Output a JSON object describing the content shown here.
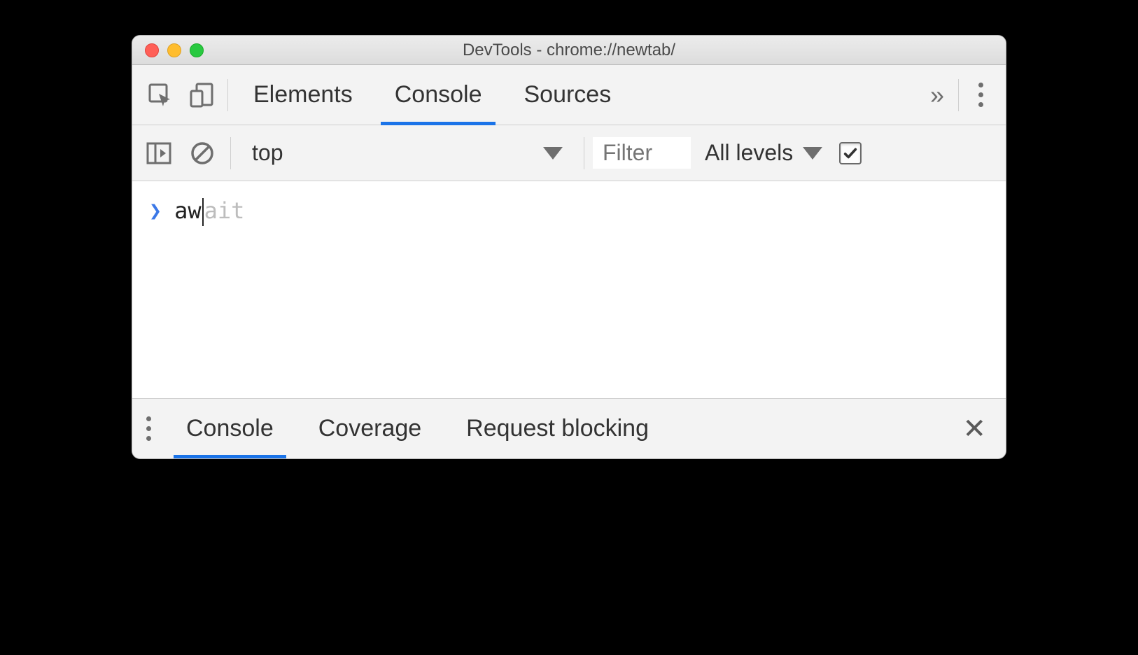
{
  "window": {
    "title": "DevTools - chrome://newtab/"
  },
  "tabs": {
    "elements": "Elements",
    "console": "Console",
    "sources": "Sources",
    "active": "Console"
  },
  "consoleToolbar": {
    "context": "top",
    "filterPlaceholder": "Filter",
    "levels": "All levels",
    "preserveChecked": true
  },
  "consoleInput": {
    "typed": "aw",
    "suggestionTail": "ait"
  },
  "drawer": {
    "console": "Console",
    "coverage": "Coverage",
    "requestBlocking": "Request blocking",
    "active": "Console"
  }
}
